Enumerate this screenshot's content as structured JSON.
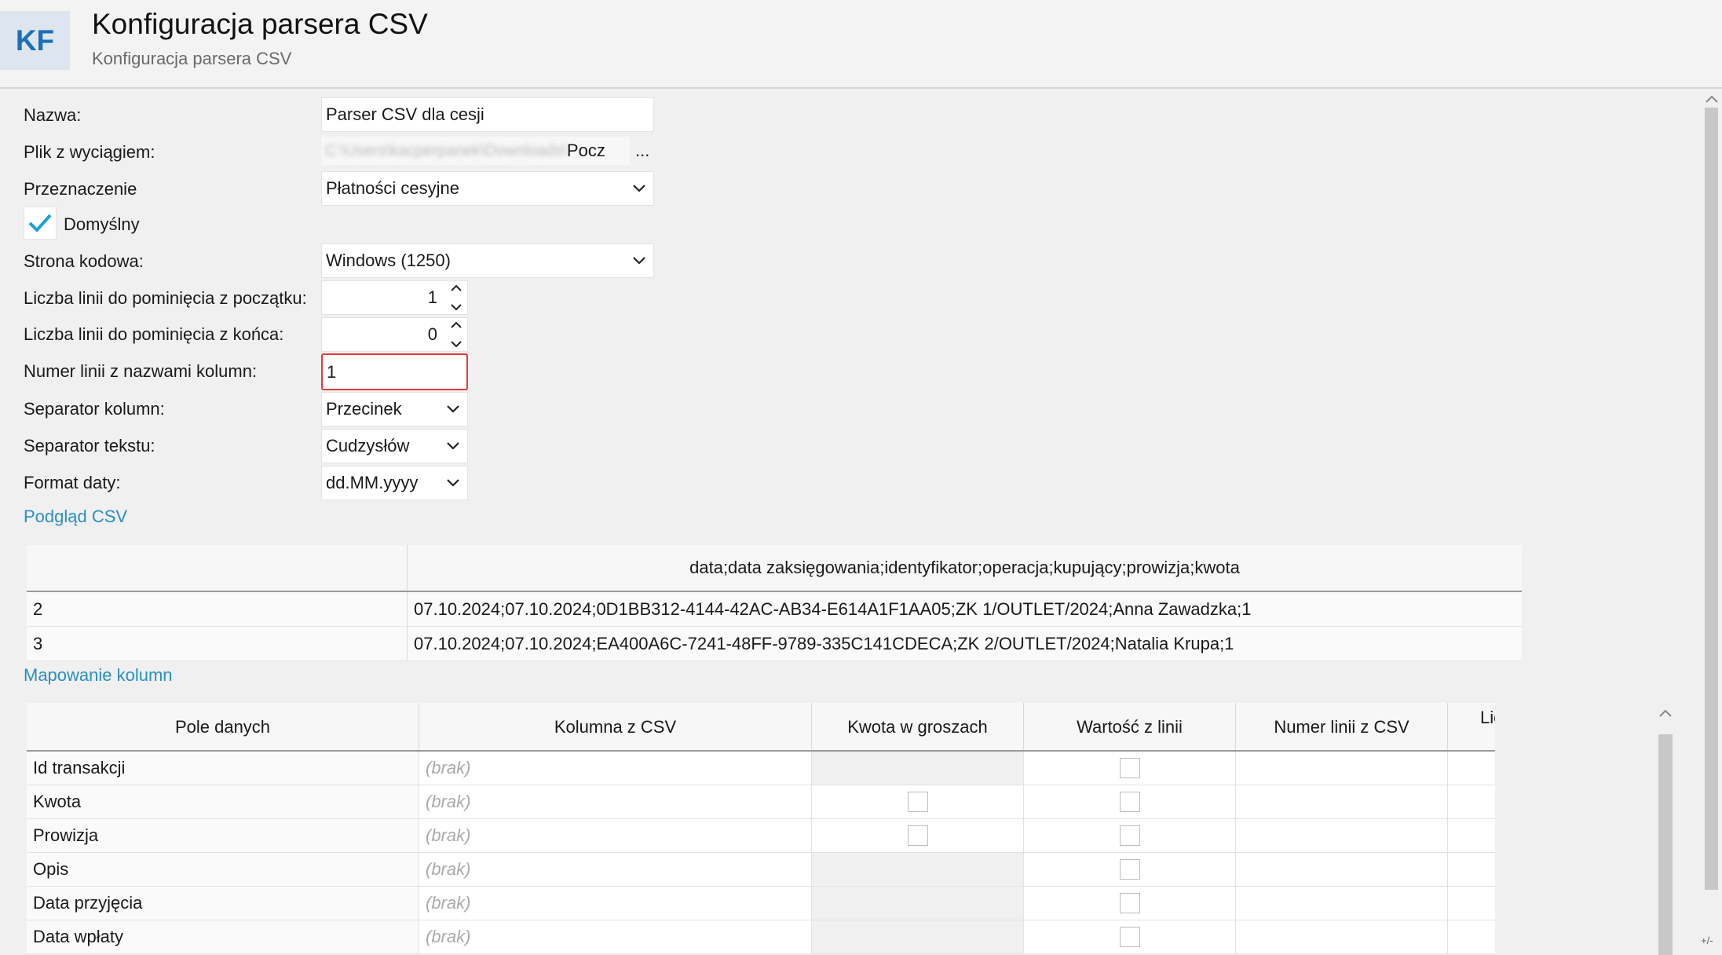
{
  "header": {
    "logo": "KF",
    "title": "Konfiguracja parsera CSV",
    "subtitle": "Konfiguracja parsera CSV"
  },
  "form": {
    "name_label": "Nazwa:",
    "name_value": "Parser CSV dla cesji",
    "file_label": "Plik z wyciągiem:",
    "file_value_blurred": "C:\\Users\\kacperpanek\\Downloads\\",
    "file_value_visible": "Pocz",
    "file_browse": "...",
    "purpose_label": "Przeznaczenie",
    "purpose_value": "Płatności cesyjne",
    "default_label": "Domyślny",
    "default_checked": true,
    "encoding_label": "Strona kodowa:",
    "encoding_value": "Windows (1250)",
    "skip_start_label": "Liczba linii do pominięcia z początku:",
    "skip_start_value": "1",
    "skip_end_label": "Liczba linii do pominięcia z końca:",
    "skip_end_value": "0",
    "header_line_label": "Numer linii z nazwami kolumn:",
    "header_line_value": "1",
    "col_sep_label": "Separator kolumn:",
    "col_sep_value": "Przecinek",
    "text_sep_label": "Separator tekstu:",
    "text_sep_value": "Cudzysłów",
    "date_format_label": "Format daty:",
    "date_format_value": "dd.MM.yyyy"
  },
  "preview": {
    "section_title": "Podgląd CSV",
    "header": "data;data zaksięgowania;identyfikator;operacja;kupujący;prowizja;kwota",
    "rows": [
      {
        "line": "2",
        "text": "07.10.2024;07.10.2024;0D1BB312-4144-42AC-AB34-E614A1F1AA05;ZK 1/OUTLET/2024;Anna Zawadzka;1"
      },
      {
        "line": "3",
        "text": "07.10.2024;07.10.2024;EA400A6C-7241-48FF-9789-335C141CDECA;ZK 2/OUTLET/2024;Natalia Krupa;1"
      }
    ]
  },
  "mapping": {
    "section_title": "Mapowanie kolumn",
    "columns": [
      "Pole danych",
      "Kolumna z CSV",
      "Kwota w groszach",
      "Wartość z linii",
      "Numer linii z CSV",
      "Licz numery linii od końca"
    ],
    "rows": [
      {
        "field": "Id transakcji",
        "csv": "(brak)"
      },
      {
        "field": "Kwota",
        "csv": "(brak)"
      },
      {
        "field": "Prowizja",
        "csv": "(brak)"
      },
      {
        "field": "Opis",
        "csv": "(brak)"
      },
      {
        "field": "Data przyjęcia",
        "csv": "(brak)"
      },
      {
        "field": "Data wpłaty",
        "csv": "(brak)"
      }
    ]
  },
  "corner_text": "+/-",
  "colors": {
    "accent": "#2a8fc0",
    "logo": "#1f6fb5",
    "error_border": "#e23a3a",
    "check": "#1da1d4"
  }
}
